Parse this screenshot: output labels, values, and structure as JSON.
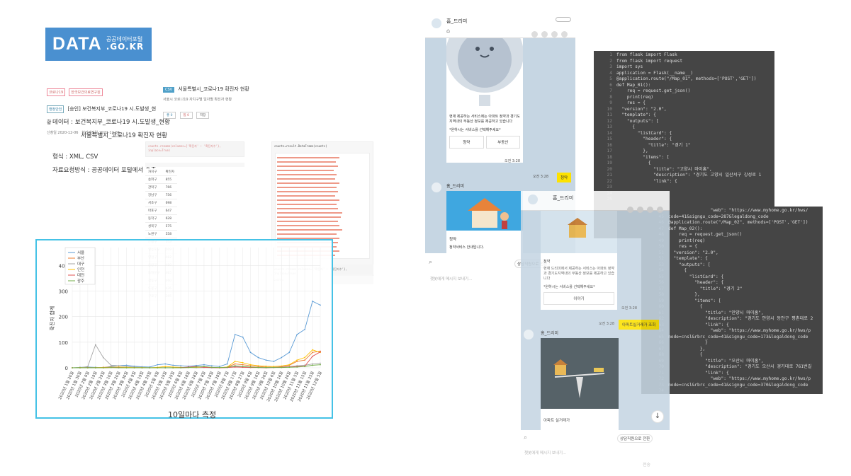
{
  "logo": {
    "big": "DATA",
    "korean": "공공데이터포털",
    "domain": ".GO.KR"
  },
  "dataset": {
    "tag1": "코로나19",
    "tag2": "한국보건의료연구원",
    "agency_tag": "행정안전",
    "title": "[승인] 보건복지부_코로나19 시.도발생_현황",
    "reg_label": "신청일",
    "reg_date": "2020-12-06",
    "proc_label": "처리예정일",
    "proc_date": "2022-12-06",
    "seoul_badge": "CSV",
    "seoul_title": "서울특별시_코로나19 확진자 현황",
    "seoul_desc": "서울시 코로나19 자치구별 일자별 확진자 현황",
    "like": "좋 0",
    "share": "찜 0",
    "save": "저장"
  },
  "info": {
    "data_line1": "데이터 : 보건복지부_코로나19 시.도발생_현황",
    "data_line2": "서울특별시_코로나19 확진자 현황",
    "format": "형식 : XML, CSV",
    "method": "자료요청방식 : 공공데이터 포털에서 추출"
  },
  "table": {
    "header": [
      "자치구",
      "확진자"
    ],
    "rows": [
      [
        "송파구",
        "855"
      ],
      [
        "관악구",
        "766"
      ],
      [
        "강남구",
        "756"
      ],
      [
        "서초구",
        "698"
      ],
      [
        "마포구",
        "647"
      ],
      [
        "동작구",
        "628"
      ],
      [
        "성북구",
        "575"
      ],
      [
        "노원구",
        "558"
      ],
      [
        "은평구",
        "553"
      ],
      [
        "영등포구",
        "509"
      ],
      [
        "양천구",
        "482"
      ],
      [
        "중랑구",
        "480"
      ],
      [
        "동대문구",
        "465"
      ],
      [
        "강동구",
        "460"
      ],
      [
        "도봉구",
        "436"
      ],
      [
        "구로구",
        "395"
      ]
    ]
  },
  "mid_code": {
    "line1": "counts.rename(columns={'확진자' : '확진자수'}, inplace=True)",
    "line2": "counts",
    "top": "counts=result.DataFrame(counts)"
  },
  "chart_data": {
    "type": "line",
    "xlabel": "",
    "ylabel": "확진자 합계",
    "caption": "10일마다 측정",
    "yticks": [
      "0",
      "100",
      "200",
      "300",
      "400"
    ],
    "ylim": [
      0,
      470
    ],
    "x": [
      "2020년 1월 20일",
      "2020년 1월 30일",
      "2020년 2월 9일",
      "2020년 2월 19일",
      "2020년 2월 29일",
      "2020년 3월 10일",
      "2020년 3월 20일",
      "2020년 3월 30일",
      "2020년 4월 9일",
      "2020년 4월 19일",
      "2020년 4월 29일",
      "2020년 5월 9일",
      "2020년 5월 19일",
      "2020년 5월 29일",
      "2020년 6월 8일",
      "2020년 6월 18일",
      "2020년 6월 28일",
      "2020년 7월 8일",
      "2020년 7월 18일",
      "2020년 7월 28일",
      "2020년 8월 7일",
      "2020년 8월 17일",
      "2020년 8월 27일",
      "2020년 9월 6일",
      "2020년 9월 16일",
      "2020년 9월 26일",
      "2020년 10월 6일",
      "2020년 10월 16일",
      "2020년 10월 26일",
      "2020년 11월 5일",
      "2020년 11월 15일",
      "2020년 11월 25일",
      "2020년 12월 5일"
    ],
    "series": [
      {
        "name": "서울",
        "color": "#5b9bd5",
        "values": [
          0,
          2,
          3,
          2,
          1,
          5,
          8,
          10,
          6,
          4,
          3,
          12,
          15,
          10,
          8,
          6,
          9,
          12,
          8,
          5,
          15,
          130,
          120,
          60,
          40,
          30,
          25,
          40,
          60,
          130,
          150,
          260,
          245
        ]
      },
      {
        "name": "부산",
        "color": "#ed7d31",
        "values": [
          0,
          0,
          1,
          0,
          2,
          3,
          2,
          1,
          1,
          0,
          0,
          1,
          0,
          0,
          1,
          2,
          3,
          2,
          1,
          0,
          3,
          15,
          12,
          8,
          5,
          3,
          2,
          5,
          10,
          25,
          30,
          60,
          65
        ]
      },
      {
        "name": "대구",
        "color": "#a5a5a5",
        "values": [
          0,
          0,
          5,
          90,
          40,
          10,
          8,
          5,
          3,
          2,
          1,
          1,
          1,
          1,
          0,
          1,
          0,
          1,
          0,
          0,
          1,
          5,
          4,
          3,
          2,
          1,
          2,
          3,
          5,
          8,
          10,
          15,
          18
        ]
      },
      {
        "name": "인천",
        "color": "#ffc000",
        "values": [
          0,
          1,
          0,
          1,
          1,
          2,
          3,
          2,
          1,
          1,
          0,
          2,
          5,
          3,
          2,
          1,
          2,
          3,
          2,
          1,
          3,
          25,
          20,
          12,
          8,
          6,
          5,
          7,
          12,
          30,
          40,
          70,
          60
        ]
      },
      {
        "name": "대전",
        "color": "#e05050",
        "values": [
          0,
          0,
          0,
          0,
          0,
          1,
          1,
          0,
          0,
          0,
          0,
          0,
          0,
          0,
          1,
          3,
          5,
          2,
          1,
          0,
          1,
          3,
          2,
          1,
          1,
          0,
          1,
          2,
          3,
          5,
          6,
          45,
          62
        ]
      },
      {
        "name": "광주",
        "color": "#70ad47",
        "values": [
          0,
          0,
          0,
          0,
          0,
          1,
          0,
          0,
          0,
          0,
          0,
          0,
          0,
          0,
          0,
          1,
          3,
          5,
          2,
          1,
          2,
          8,
          5,
          3,
          1,
          1,
          1,
          1,
          2,
          3,
          5,
          10,
          12
        ]
      }
    ]
  },
  "chat1": {
    "name": "홈_드리미",
    "intro": "현재 제공하는 서비스에는 아파트 정약과 경기도지역내의 부동산 정보를 제공하고 있습니다",
    "select": "*원하시는 서비스를 선택해주세요*",
    "btn1": "청약",
    "btn2": "부동산",
    "time1": "오전 3:28",
    "reply": "청약",
    "time2": "오전 3:28",
    "name2": "홈_드리미",
    "card2_title": "청약",
    "card2_desc": "청약서비스 안내입니다.",
    "handoff": "상담직원으로 전환",
    "placeholder": "챗봇에게 메시지 보내기..."
  },
  "chat2": {
    "name": "홈_드리미",
    "card_body1": "청약",
    "card_body2": "현재 드리미에서 제공하는 서비스는 아파트 정약과 경기도지역내의 부동산 정보를 제공하고 있습니다",
    "card_body3": "*원하시는 서비스를 선택해주세요*",
    "card_btn": "이야기",
    "time1": "오전 3:28",
    "reply": "아파트실거래가 조회",
    "time2": "오전 3:28",
    "name2": "홈_드리미",
    "card2_title": "아파트 실거래가",
    "handoff": "상담직원으로 전환",
    "placeholder": "챗봇에게 메시지 보내기...",
    "send": "전송"
  },
  "code1": {
    "lines": [
      "from flask import Flask",
      "from flask import request",
      "import sys",
      "application = Flask(__name__)",
      "",
      "",
      "@application.route(\"/Map_01\", methods=['POST','GET'])",
      "def Map_01():",
      "",
      "    req = request.get_json()",
      "    print(req)",
      "    res = {",
      "  \"version\": \"2.0\",",
      "  \"template\": {",
      "    \"outputs\": [",
      "      {",
      "        \"listCard\": {",
      "          \"header\": {",
      "            \"title\": \"경기 1\"",
      "          },",
      "          \"items\": [",
      "            {",
      "              \"title\": \"고양시 마이홈\",",
      "              \"description\": \"경기도 고양시 일산서구 강성로 1",
      "              \"link\": {"
    ]
  },
  "code2": {
    "lines": [
      "                \"web\": \"https://www.myhome.go.kr/hws/",
      "code=41&signgu_code=287&legaldong_code",
      "",
      "@application.route(\"/Map_02\", methods=['POST','GET'])",
      "def Map_02():",
      "",
      "    req = request.get_json()",
      "    print(req)",
      "    res = {",
      "  \"version\": \"2.0\",",
      "  \"template\": {",
      "    \"outputs\": [",
      "      {",
      "        \"listCard\": {",
      "          \"header\": {",
      "            \"title\": \"경기 2\"",
      "          },",
      "          \"items\": [",
      "            {",
      "              \"title\": \"안양시 마이홈\",",
      "              \"description\": \"경기도 안양시 동안구 평촌대로 2",
      "              \"link\": {",
      "                \"web\": \"https://www.myhome.go.kr/hws/p",
      "mode=cnsl&rbrc_code=41&signgu_code=173&legaldong_code",
      "              }",
      "            },",
      "            {",
      "              \"title\": \"오산시 마이홈\",",
      "              \"description\": \"경기도 오산시 경기대로 761번길",
      "              \"link\": {",
      "                \"web\": \"https://www.myhome.go.kr/hws/p",
      "mode=cnsl&rbrc_code=41&signgu_code=370&legaldong_code"
    ]
  }
}
